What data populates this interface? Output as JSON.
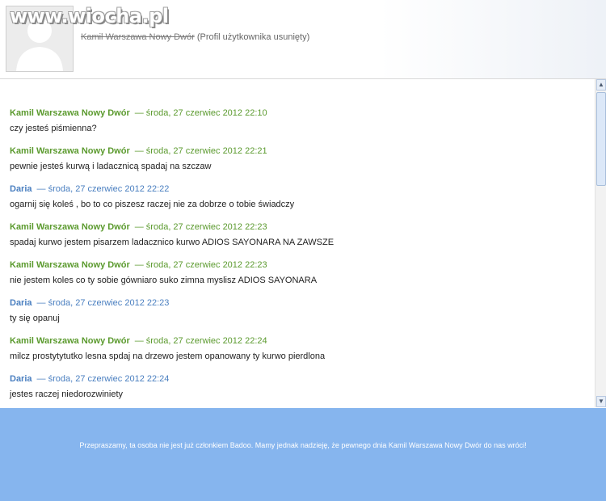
{
  "watermark": "www.wiocha.pl",
  "profile": {
    "name": "Kamil Warszawa Nowy Dwór",
    "status": "(Profil użytkownika usunięty)"
  },
  "messages": [
    {
      "sender": "Kamil Warszawa Nowy Dwór",
      "date": "— środa, 27 czerwiec 2012 22:10",
      "text": "czy jesteś piśmienna?"
    },
    {
      "sender": "Kamil Warszawa Nowy Dwór",
      "date": "— środa, 27 czerwiec 2012 22:21",
      "text": "pewnie jesteś kurwą i ladacznicą spadaj na szczaw"
    },
    {
      "sender": "Daria",
      "date": "— środa, 27 czerwiec 2012 22:22",
      "text": "ogarnij się koleś , bo to co piszesz raczej nie za dobrze o tobie świadczy"
    },
    {
      "sender": "Kamil Warszawa Nowy Dwór",
      "date": "— środa, 27 czerwiec 2012 22:23",
      "text": "spadaj kurwo jestem pisarzem ladacznico kurwo ADIOS SAYONARA NA ZAWSZE"
    },
    {
      "sender": "Kamil Warszawa Nowy Dwór",
      "date": "— środa, 27 czerwiec 2012 22:23",
      "text": "nie jestem koles co ty sobie gówniaro suko zimna myslisz ADIOS SAYONARA"
    },
    {
      "sender": "Daria",
      "date": "— środa, 27 czerwiec 2012 22:23",
      "text": "ty się opanuj"
    },
    {
      "sender": "Kamil Warszawa Nowy Dwór",
      "date": "— środa, 27 czerwiec 2012 22:24",
      "text": "milcz prostytytutko lesna spdaj na drzewo jestem opanowany ty kurwo pierdlona"
    },
    {
      "sender": "Daria",
      "date": "— środa, 27 czerwiec 2012 22:24",
      "text": "jestes raczej niedorozwiniety"
    }
  ],
  "scrollbar": {
    "up_icon": "▲",
    "down_icon": "▼"
  },
  "footer": {
    "text": "Przepraszamy, ta osoba nie jest już członkiem Badoo. Mamy jednak nadzieję, że pewnego dnia Kamil Warszawa Nowy Dwór do nas wróci!"
  },
  "colors": {
    "accent_green": "#5b9a2e",
    "accent_blue": "#4a7fc0",
    "footer_bg": "#86b5ee"
  }
}
